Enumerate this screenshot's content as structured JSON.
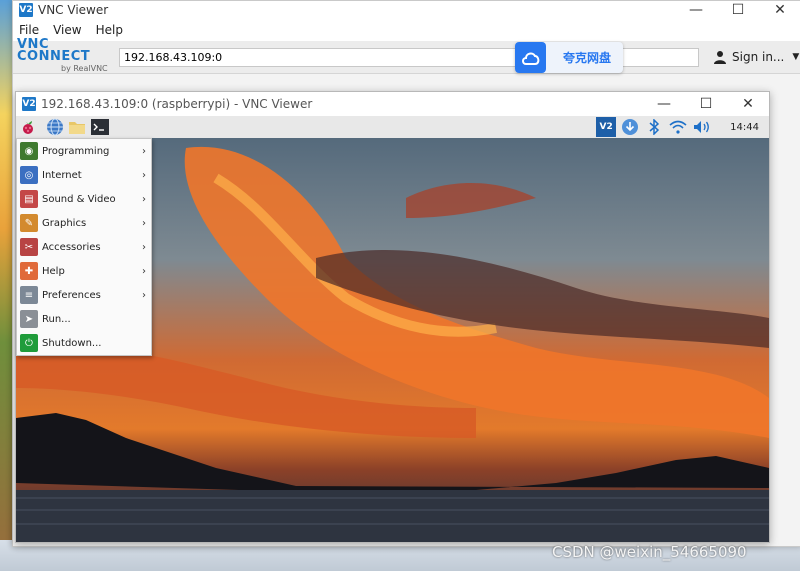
{
  "outer_window": {
    "title": "VNC Viewer",
    "controls": {
      "minimize": "—",
      "maximize": "☐",
      "close": "✕"
    }
  },
  "menubar": {
    "items": [
      "File",
      "View",
      "Help"
    ]
  },
  "toolbar": {
    "brand": "VNC CONNECT",
    "brand_sub": "by RealVNC",
    "address_value": "192.168.43.109:0",
    "signin_label": "Sign in...",
    "caret": "▼"
  },
  "cloud_widget": {
    "label": "夸克网盘",
    "icon": "cloud-icon",
    "color": "#2878f0"
  },
  "inner_window": {
    "title": "192.168.43.109:0 (raspberrypi) - VNC Viewer",
    "controls": {
      "minimize": "—",
      "maximize": "☐",
      "close": "✕"
    }
  },
  "panel": {
    "launchers": [
      "raspberry-icon",
      "globe-icon",
      "folder-icon",
      "terminal-icon"
    ],
    "tray": [
      "vnc-icon",
      "download-icon",
      "bluetooth-icon",
      "wifi-icon",
      "volume-icon"
    ],
    "clock": "14:44"
  },
  "start_menu": {
    "items": [
      {
        "label": "Programming",
        "icon": "programming-icon",
        "color": "#3f7a2f",
        "submenu": true
      },
      {
        "label": "Internet",
        "icon": "internet-icon",
        "color": "#3b6fc1",
        "submenu": true
      },
      {
        "label": "Sound & Video",
        "icon": "sound-video-icon",
        "color": "#c44747",
        "submenu": true
      },
      {
        "label": "Graphics",
        "icon": "graphics-icon",
        "color": "#d38a2e",
        "submenu": true
      },
      {
        "label": "Accessories",
        "icon": "accessories-icon",
        "color": "#b84444",
        "submenu": true
      },
      {
        "label": "Help",
        "icon": "help-icon",
        "color": "#e06a3a",
        "submenu": true
      },
      {
        "label": "Preferences",
        "icon": "preferences-icon",
        "color": "#7c8896",
        "submenu": true
      },
      {
        "label": "Run...",
        "icon": "run-icon",
        "color": "#8a8f96",
        "submenu": false
      },
      {
        "label": "Shutdown...",
        "icon": "shutdown-icon",
        "color": "#1f9c3b",
        "submenu": false
      }
    ],
    "arrow": "›"
  },
  "watermark": "CSDN @weixin_54665090"
}
